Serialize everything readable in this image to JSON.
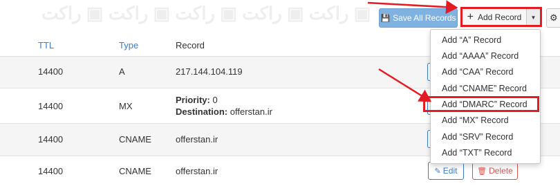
{
  "toolbar": {
    "save_label": "Save All Records",
    "add_label": "Add Record"
  },
  "table": {
    "headers": {
      "ttl": "TTL",
      "type": "Type",
      "record": "Record"
    },
    "rows": [
      {
        "ttl": "14400",
        "type": "A",
        "record": "217.144.104.119"
      },
      {
        "ttl": "14400",
        "type": "MX",
        "priority_label": "Priority:",
        "priority_value": "0",
        "destination_label": "Destination:",
        "destination_value": "offerstan.ir"
      },
      {
        "ttl": "14400",
        "type": "CNAME",
        "record": "offerstan.ir"
      },
      {
        "ttl": "14400",
        "type": "CNAME",
        "record": "offerstan.ir"
      }
    ],
    "edit_label": "Edit",
    "delete_label": "Delete"
  },
  "dropdown": {
    "items": [
      "Add “A” Record",
      "Add “AAAA” Record",
      "Add “CAA” Record",
      "Add “CNAME” Record",
      "Add “DMARC” Record",
      "Add “MX” Record",
      "Add “SRV” Record",
      "Add “TXT” Record"
    ]
  },
  "colors": {
    "accent_blue": "#3a7fc1",
    "save_button": "#7fb2e0",
    "delete_red": "#d9534f",
    "highlight_red": "#e31b23"
  },
  "icons": {
    "save": "floppy-disk-icon",
    "add": "plus-icon",
    "caret": "caret-down-icon",
    "settings": "gear-icon",
    "edit": "pencil-icon",
    "delete": "trash-icon"
  }
}
